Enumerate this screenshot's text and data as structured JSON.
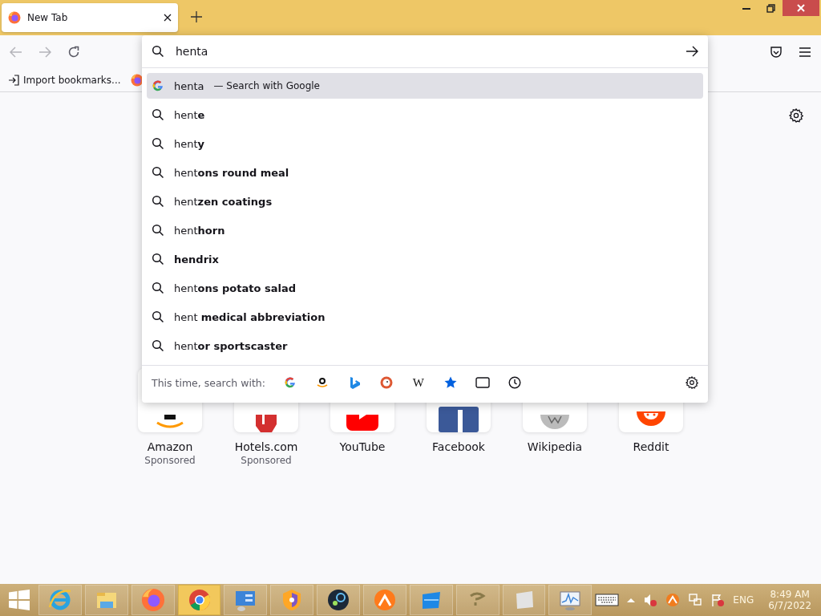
{
  "tab": {
    "title": "New Tab",
    "selected": true
  },
  "toolbar": {
    "back_disabled": true,
    "forward_disabled": true
  },
  "bookmarks": [
    {
      "kind": "import",
      "label": "Import bookmarks..."
    },
    {
      "kind": "firefox"
    }
  ],
  "urlbar": {
    "value": "henta"
  },
  "suggestions": [
    {
      "kind": "engine",
      "text": "henta",
      "note": "— Search with Google",
      "selected": true
    },
    {
      "kind": "search",
      "text": "hent**e**",
      "selected": false
    },
    {
      "kind": "search",
      "text": "hent**y**",
      "selected": false
    },
    {
      "kind": "search",
      "text": "hent**ons round meal**",
      "selected": false
    },
    {
      "kind": "search",
      "text": "hent**zen coatings**",
      "selected": false
    },
    {
      "kind": "search",
      "text": "hent**horn**",
      "selected": false
    },
    {
      "kind": "search",
      "text": "**hendrix**",
      "selected": false
    },
    {
      "kind": "search",
      "text": "hent**ons potato salad**",
      "selected": false
    },
    {
      "kind": "search",
      "text": "hent **medical abbreviation**",
      "selected": false
    },
    {
      "kind": "search",
      "text": "hent**or sportscaster**",
      "selected": false
    }
  ],
  "one_off": {
    "label": "This time, search with:",
    "engines": [
      {
        "kind": "google"
      },
      {
        "kind": "amazon"
      },
      {
        "kind": "bing"
      },
      {
        "kind": "duckduckgo"
      },
      {
        "kind": "wikipedia",
        "glyph": "W"
      },
      {
        "kind": "bookmarks"
      },
      {
        "kind": "tabs"
      },
      {
        "kind": "history"
      }
    ]
  },
  "top_sites": [
    {
      "kind": "amazon",
      "title": "Amazon",
      "sponsored": "Sponsored"
    },
    {
      "kind": "hotels",
      "title": "Hotels.com",
      "sponsored": "Sponsored"
    },
    {
      "kind": "youtube",
      "title": "YouTube"
    },
    {
      "kind": "facebook",
      "title": "Facebook"
    },
    {
      "kind": "wikipedia",
      "title": "Wikipedia"
    },
    {
      "kind": "reddit",
      "title": "Reddit"
    }
  ],
  "taskbar": {
    "apps": [
      {
        "kind": "ie",
        "selected": false
      },
      {
        "kind": "explorer",
        "selected": false
      },
      {
        "kind": "firefox",
        "selected": false
      },
      {
        "kind": "chrome",
        "selected": true
      },
      {
        "kind": "panel",
        "selected": false
      },
      {
        "kind": "vpn",
        "selected": false
      },
      {
        "kind": "steam",
        "selected": false
      },
      {
        "kind": "orange",
        "selected": false
      },
      {
        "kind": "bluebox",
        "selected": false
      },
      {
        "kind": "squiggle",
        "selected": false
      },
      {
        "kind": "whitebox",
        "selected": false
      },
      {
        "kind": "monitor",
        "selected": false
      }
    ],
    "language": "ENG",
    "time": "8:49 AM",
    "date": "6/7/2022"
  }
}
